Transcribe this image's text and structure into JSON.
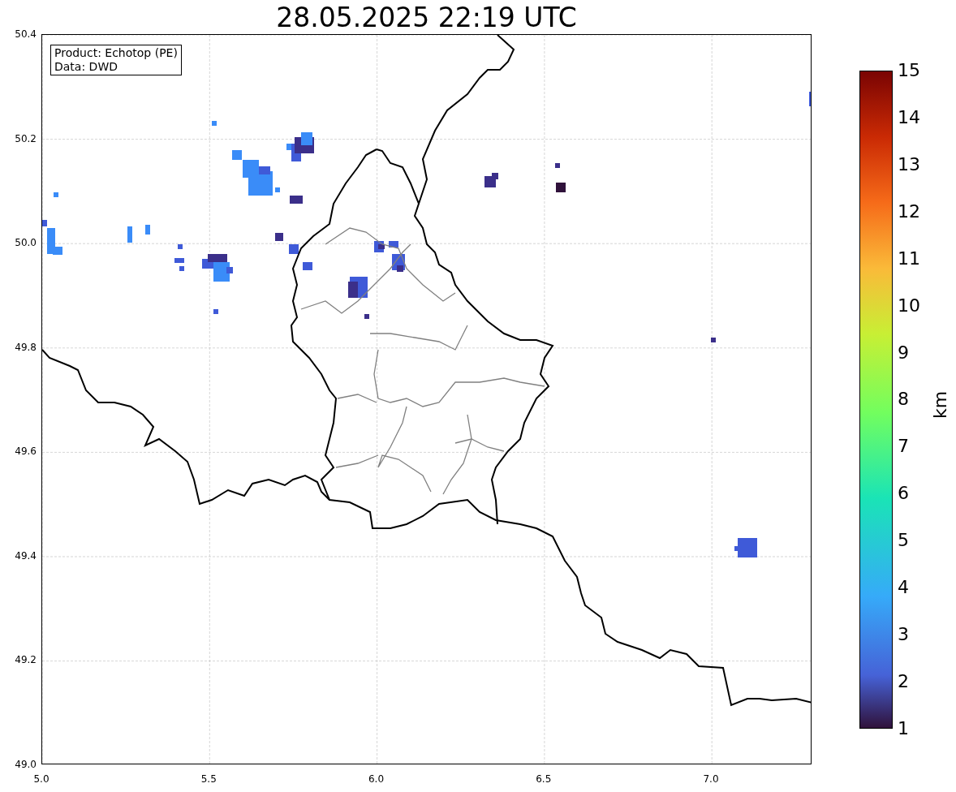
{
  "title": "28.05.2025 22:19 UTC",
  "annotation": [
    "Product: Echotop (PE)",
    "Data: DWD"
  ],
  "y_ticks": [
    "50.4",
    "50.2",
    "50.0",
    "49.8",
    "49.6",
    "49.4",
    "49.2",
    "49.0"
  ],
  "x_ticks": [
    "5.0",
    "5.5",
    "6.0",
    "6.5",
    "7.0"
  ],
  "colorbar": {
    "ticks": [
      "15",
      "14",
      "13",
      "12",
      "11",
      "10",
      "9",
      "8",
      "7",
      "6",
      "5",
      "4",
      "3",
      "2",
      "1"
    ],
    "label": "km"
  }
}
